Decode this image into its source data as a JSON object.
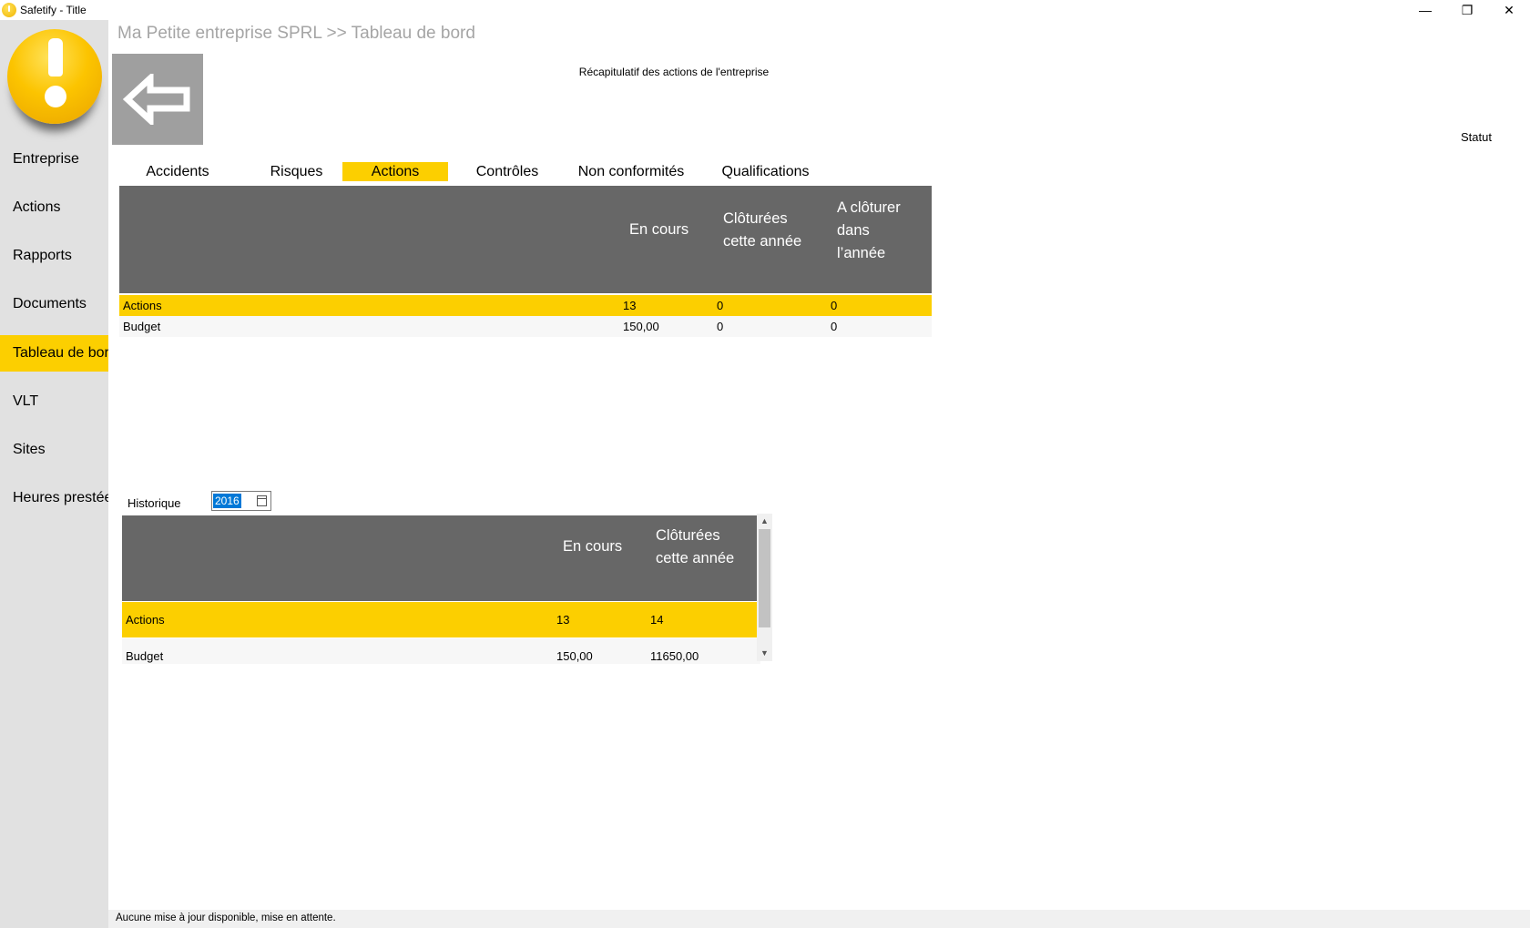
{
  "window": {
    "title": "Safetify - Title",
    "minimize": "—",
    "maximize": "❐",
    "close": "✕"
  },
  "sidebar": {
    "logo": "warning-logo",
    "items": [
      {
        "label": "Entreprise"
      },
      {
        "label": "Actions"
      },
      {
        "label": "Rapports"
      },
      {
        "label": "Documents"
      },
      {
        "label": "Tableau de bord",
        "active": true
      },
      {
        "label": "VLT"
      },
      {
        "label": "Sites"
      },
      {
        "label": "Heures prestées"
      }
    ]
  },
  "main": {
    "breadcrumb": "Ma Petite entreprise SPRL >> Tableau de bord",
    "back_icon": "arrow-left-icon",
    "summary_title": "Récapitulatif des actions de l'entreprise",
    "statut_label": "Statut",
    "tabs": [
      {
        "label": "Accidents"
      },
      {
        "label": "Risques"
      },
      {
        "label": "Actions",
        "active": true
      },
      {
        "label": "Contrôles"
      },
      {
        "label": "Non conformités"
      },
      {
        "label": "Qualifications"
      }
    ],
    "summary_table": {
      "headers": [
        "En cours",
        "Clôturées cette année",
        "A clôturer dans l’année"
      ],
      "rows": [
        {
          "label": "Actions",
          "en_cours": "13",
          "cloturees": "0",
          "a_cloturer": "0",
          "selected": true
        },
        {
          "label": "Budget",
          "en_cours": "150,00",
          "cloturees": "0",
          "a_cloturer": "0"
        }
      ]
    },
    "history": {
      "label": "Historique",
      "year": "2016",
      "headers": [
        "En cours",
        "Clôturées cette année"
      ],
      "rows": [
        {
          "label": "Actions",
          "en_cours": "13",
          "cloturees": "14",
          "selected": true
        },
        {
          "label": "Budget",
          "en_cours": "150,00",
          "cloturees": "11650,00"
        }
      ]
    }
  },
  "status_bar": {
    "text": "Aucune mise à jour disponible, mise en attente."
  },
  "colors": {
    "accent": "#fccf00",
    "header_bg": "#676767",
    "sidebar_bg": "#e1e1e1",
    "back_button": "#9f9f9f"
  }
}
